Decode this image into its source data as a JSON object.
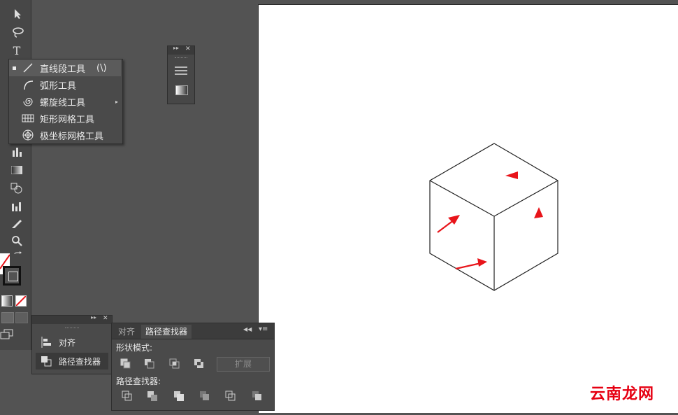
{
  "flyout": {
    "items": [
      {
        "label": "直线段工具",
        "shortcut": "(\\)",
        "icon": "line-segment-icon"
      },
      {
        "label": "弧形工具",
        "icon": "arc-icon"
      },
      {
        "label": "螺旋线工具",
        "icon": "spiral-icon"
      },
      {
        "label": "矩形网格工具",
        "icon": "rect-grid-icon"
      },
      {
        "label": "极坐标网格工具",
        "icon": "polar-grid-icon"
      }
    ]
  },
  "dock": {
    "items": [
      {
        "label": "对齐",
        "icon": "align-icon"
      },
      {
        "label": "路径查找器",
        "icon": "pathfinder-icon"
      }
    ]
  },
  "pathfinder": {
    "tabs": [
      "对齐",
      "路径查找器"
    ],
    "shape_modes_label": "形状模式:",
    "expand_label": "扩展",
    "pathfinders_label": "路径查找器:"
  },
  "watermark": "云南龙网",
  "colors": {
    "arrow": "#e8141a",
    "accent_bg": "#535353"
  }
}
